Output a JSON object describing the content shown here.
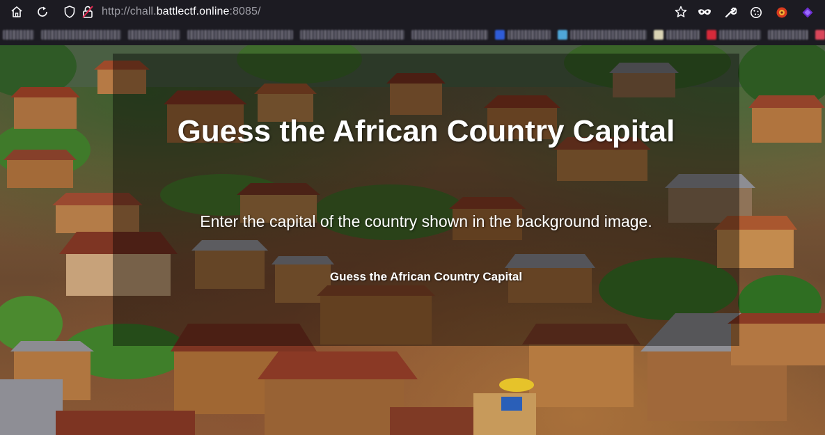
{
  "browser": {
    "url_prefix": "http://chall.",
    "url_host": "battlectf.online",
    "url_suffix": ":8085/",
    "nav_icons": [
      "home-icon",
      "reload-icon"
    ],
    "security_icons": [
      "shield-icon",
      "insecure-lock-icon"
    ],
    "toolbar_icons": [
      "bookmark-star-icon",
      "mask-extension-icon",
      "wrench-icon",
      "cookie-icon",
      "extension-red-icon",
      "extension-purple-icon"
    ],
    "accent_color": "#1c1b22"
  },
  "page": {
    "title": "Guess the African Country Capital",
    "subtitle": "Enter the capital of the country shown in the background image.",
    "form_title": "Guess the African Country Capital",
    "overlay_color": "rgba(0,0,0,0.40)",
    "text_color": "#ffffff"
  }
}
